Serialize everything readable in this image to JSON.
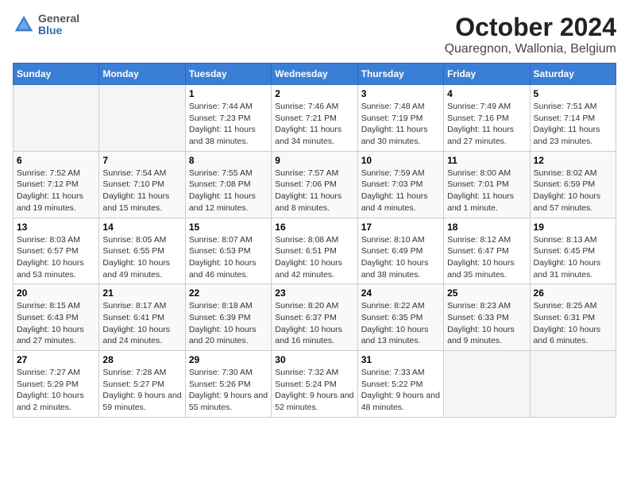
{
  "header": {
    "logo_line1": "General",
    "logo_line2": "Blue",
    "title": "October 2024",
    "subtitle": "Quaregnon, Wallonia, Belgium"
  },
  "columns": [
    "Sunday",
    "Monday",
    "Tuesday",
    "Wednesday",
    "Thursday",
    "Friday",
    "Saturday"
  ],
  "weeks": [
    [
      {
        "day": "",
        "detail": ""
      },
      {
        "day": "",
        "detail": ""
      },
      {
        "day": "1",
        "detail": "Sunrise: 7:44 AM\nSunset: 7:23 PM\nDaylight: 11 hours and 38 minutes."
      },
      {
        "day": "2",
        "detail": "Sunrise: 7:46 AM\nSunset: 7:21 PM\nDaylight: 11 hours and 34 minutes."
      },
      {
        "day": "3",
        "detail": "Sunrise: 7:48 AM\nSunset: 7:19 PM\nDaylight: 11 hours and 30 minutes."
      },
      {
        "day": "4",
        "detail": "Sunrise: 7:49 AM\nSunset: 7:16 PM\nDaylight: 11 hours and 27 minutes."
      },
      {
        "day": "5",
        "detail": "Sunrise: 7:51 AM\nSunset: 7:14 PM\nDaylight: 11 hours and 23 minutes."
      }
    ],
    [
      {
        "day": "6",
        "detail": "Sunrise: 7:52 AM\nSunset: 7:12 PM\nDaylight: 11 hours and 19 minutes."
      },
      {
        "day": "7",
        "detail": "Sunrise: 7:54 AM\nSunset: 7:10 PM\nDaylight: 11 hours and 15 minutes."
      },
      {
        "day": "8",
        "detail": "Sunrise: 7:55 AM\nSunset: 7:08 PM\nDaylight: 11 hours and 12 minutes."
      },
      {
        "day": "9",
        "detail": "Sunrise: 7:57 AM\nSunset: 7:06 PM\nDaylight: 11 hours and 8 minutes."
      },
      {
        "day": "10",
        "detail": "Sunrise: 7:59 AM\nSunset: 7:03 PM\nDaylight: 11 hours and 4 minutes."
      },
      {
        "day": "11",
        "detail": "Sunrise: 8:00 AM\nSunset: 7:01 PM\nDaylight: 11 hours and 1 minute."
      },
      {
        "day": "12",
        "detail": "Sunrise: 8:02 AM\nSunset: 6:59 PM\nDaylight: 10 hours and 57 minutes."
      }
    ],
    [
      {
        "day": "13",
        "detail": "Sunrise: 8:03 AM\nSunset: 6:57 PM\nDaylight: 10 hours and 53 minutes."
      },
      {
        "day": "14",
        "detail": "Sunrise: 8:05 AM\nSunset: 6:55 PM\nDaylight: 10 hours and 49 minutes."
      },
      {
        "day": "15",
        "detail": "Sunrise: 8:07 AM\nSunset: 6:53 PM\nDaylight: 10 hours and 46 minutes."
      },
      {
        "day": "16",
        "detail": "Sunrise: 8:08 AM\nSunset: 6:51 PM\nDaylight: 10 hours and 42 minutes."
      },
      {
        "day": "17",
        "detail": "Sunrise: 8:10 AM\nSunset: 6:49 PM\nDaylight: 10 hours and 38 minutes."
      },
      {
        "day": "18",
        "detail": "Sunrise: 8:12 AM\nSunset: 6:47 PM\nDaylight: 10 hours and 35 minutes."
      },
      {
        "day": "19",
        "detail": "Sunrise: 8:13 AM\nSunset: 6:45 PM\nDaylight: 10 hours and 31 minutes."
      }
    ],
    [
      {
        "day": "20",
        "detail": "Sunrise: 8:15 AM\nSunset: 6:43 PM\nDaylight: 10 hours and 27 minutes."
      },
      {
        "day": "21",
        "detail": "Sunrise: 8:17 AM\nSunset: 6:41 PM\nDaylight: 10 hours and 24 minutes."
      },
      {
        "day": "22",
        "detail": "Sunrise: 8:18 AM\nSunset: 6:39 PM\nDaylight: 10 hours and 20 minutes."
      },
      {
        "day": "23",
        "detail": "Sunrise: 8:20 AM\nSunset: 6:37 PM\nDaylight: 10 hours and 16 minutes."
      },
      {
        "day": "24",
        "detail": "Sunrise: 8:22 AM\nSunset: 6:35 PM\nDaylight: 10 hours and 13 minutes."
      },
      {
        "day": "25",
        "detail": "Sunrise: 8:23 AM\nSunset: 6:33 PM\nDaylight: 10 hours and 9 minutes."
      },
      {
        "day": "26",
        "detail": "Sunrise: 8:25 AM\nSunset: 6:31 PM\nDaylight: 10 hours and 6 minutes."
      }
    ],
    [
      {
        "day": "27",
        "detail": "Sunrise: 7:27 AM\nSunset: 5:29 PM\nDaylight: 10 hours and 2 minutes."
      },
      {
        "day": "28",
        "detail": "Sunrise: 7:28 AM\nSunset: 5:27 PM\nDaylight: 9 hours and 59 minutes."
      },
      {
        "day": "29",
        "detail": "Sunrise: 7:30 AM\nSunset: 5:26 PM\nDaylight: 9 hours and 55 minutes."
      },
      {
        "day": "30",
        "detail": "Sunrise: 7:32 AM\nSunset: 5:24 PM\nDaylight: 9 hours and 52 minutes."
      },
      {
        "day": "31",
        "detail": "Sunrise: 7:33 AM\nSunset: 5:22 PM\nDaylight: 9 hours and 48 minutes."
      },
      {
        "day": "",
        "detail": ""
      },
      {
        "day": "",
        "detail": ""
      }
    ]
  ]
}
